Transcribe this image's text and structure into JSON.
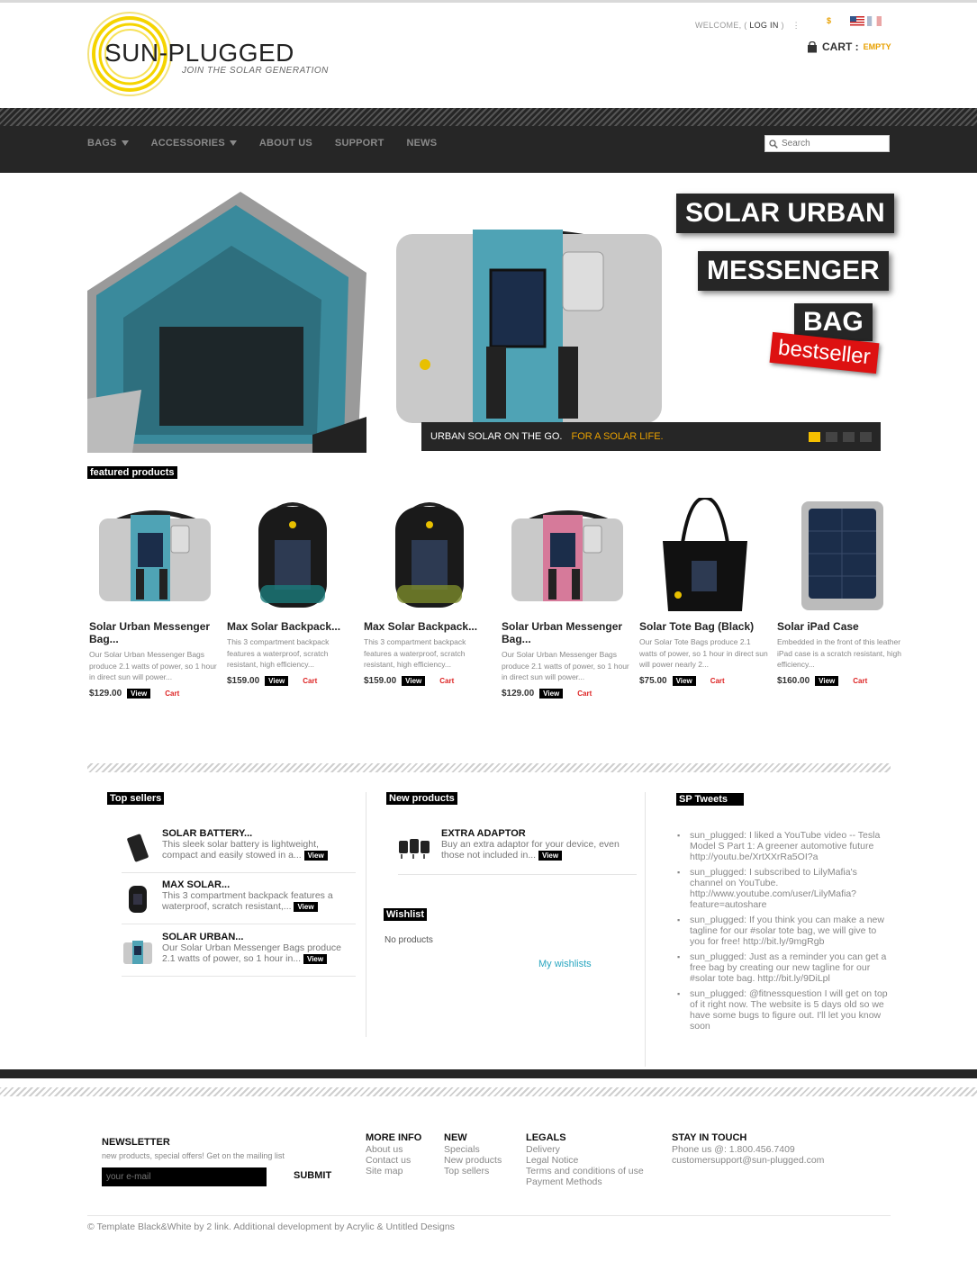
{
  "header": {
    "logo_name": "SUN-PLUGGED",
    "logo_tagline": "JOIN THE SOLAR GENERATION",
    "welcome_text": "WELCOME, (",
    "login_label": "LOG IN",
    "welcome_close": ")",
    "currency_symbol": "$",
    "cart_label": "CART :",
    "cart_status": "EMPTY"
  },
  "nav": {
    "items": [
      "BAGS",
      "ACCESSORIES",
      "ABOUT US",
      "SUPPORT",
      "NEWS"
    ],
    "search_placeholder": "Search"
  },
  "slider": {
    "headline_1": "SOLAR URBAN",
    "headline_2": "MESSENGER",
    "headline_3": "BAG",
    "badge": "bestseller",
    "caption_main": "URBAN SOLAR ON THE GO.",
    "caption_highlight": "FOR A SOLAR LIFE."
  },
  "featured": {
    "label": "featured products",
    "view_label": "View",
    "cart_label": "Cart",
    "products": [
      {
        "name": "Solar Urban Messenger Bag...",
        "desc": "Our Solar Urban Messenger Bags produce 2.1 watts of power, so 1 hour in direct sun will power...",
        "price": "$129.00",
        "color": "#4fa3b5"
      },
      {
        "name": "Max Solar Backpack...",
        "desc": "This 3 compartment backpack features a waterproof, scratch resistant, high efficiency...",
        "price": "$159.00",
        "color": "#1a7a7a"
      },
      {
        "name": "Max Solar Backpack...",
        "desc": "This 3 compartment backpack features a waterproof, scratch resistant, high efficiency...",
        "price": "$159.00",
        "color": "#7a8a2a"
      },
      {
        "name": "Solar Urban Messenger Bag...",
        "desc": "Our Solar Urban Messenger Bags produce 2.1 watts of power, so 1 hour in direct sun will power...",
        "price": "$129.00",
        "color": "#d67a9a"
      },
      {
        "name": "Solar Tote Bag (Black)",
        "desc": "Our Solar Tote Bags produce 2.1 watts of power, so 1 hour in direct sun will power nearly 2...",
        "price": "$75.00",
        "color": "#111111"
      },
      {
        "name": "Solar iPad Case",
        "desc": "Embedded in the front of this leather iPad case is a scratch resistant, high efficiency...",
        "price": "$160.00",
        "color": "#bbbbbb"
      }
    ]
  },
  "top_sellers": {
    "label": "Top sellers",
    "items": [
      {
        "title": "SOLAR BATTERY...",
        "desc": "This sleek solar battery is lightweight, compact and easily stowed in a..."
      },
      {
        "title": "MAX SOLAR...",
        "desc": "This 3 compartment backpack features a waterproof, scratch resistant,..."
      },
      {
        "title": "SOLAR URBAN...",
        "desc": "Our Solar Urban Messenger Bags produce 2.1 watts of power, so 1 hour in..."
      }
    ]
  },
  "new_products": {
    "label": "New products",
    "items": [
      {
        "title": "EXTRA ADAPTOR",
        "desc": "Buy an extra adaptor for your device, even those not included in..."
      }
    ]
  },
  "wishlist": {
    "label": "Wishlist",
    "empty_text": "No products",
    "link": "My wishlists"
  },
  "tweets": {
    "label": "SP Tweets",
    "items": [
      "sun_plugged: I liked a YouTube video -- Tesla Model S Part 1: A greener automotive future http://youtu.be/XrtXXrRa5OI?a",
      "sun_plugged: I subscribed to LilyMafia's channel on YouTube. http://www.youtube.com/user/LilyMafia?feature=autoshare",
      "sun_plugged: If you think you can make a new tagline for our #solar tote bag, we will give to you for free! http://bit.ly/9mgRgb",
      "sun_plugged: Just as a reminder you can get a free bag by creating our new tagline for our #solar tote bag. http://bit.ly/9DiLpl",
      "sun_plugged: @fitnessquestion I will get on top of it right now. The website is 5 days old so we have some bugs to figure out. I'll let you know soon"
    ]
  },
  "footer": {
    "newsletter_title": "NEWSLETTER",
    "newsletter_desc": "new products, special offers! Get on the mailing list",
    "email_placeholder": "your e-mail",
    "submit_label": "SUBMIT",
    "more_info_title": "MORE INFO",
    "more_info_links": [
      "About us",
      "Contact us",
      "Site map"
    ],
    "new_title": "NEW",
    "new_links": [
      "Specials",
      "New products",
      "Top sellers"
    ],
    "legals_title": "LEGALS",
    "legals_links": [
      "Delivery",
      "Legal Notice",
      "Terms and conditions of use",
      "Payment Methods"
    ],
    "stay_title": "STAY IN TOUCH",
    "phone": "Phone us @: 1.800.456.7409",
    "email": "customersupport@sun-plugged.com",
    "copyright": "© Template Black&White by 2 link. Additional development by Acrylic & Untitled Designs"
  },
  "colors": {
    "accent": "#e8a000",
    "dark": "#262626",
    "red": "#dd1111"
  }
}
